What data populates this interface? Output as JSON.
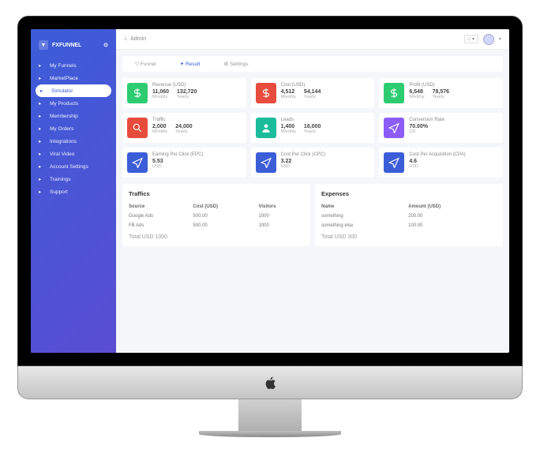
{
  "brand": "FXFUNNEL",
  "topbar": {
    "title": "Admin"
  },
  "nav": [
    {
      "label": "My Funnels"
    },
    {
      "label": "MarketPlace"
    },
    {
      "label": "Simulator",
      "active": true
    },
    {
      "label": "My Products"
    },
    {
      "label": "Membership"
    },
    {
      "label": "My Orders"
    },
    {
      "label": "Integrations"
    },
    {
      "label": "Viral Video"
    },
    {
      "label": "Account Settings"
    },
    {
      "label": "Trainings"
    },
    {
      "label": "Support"
    }
  ],
  "tabs": {
    "funnel": "Funnel",
    "result": "Result",
    "settings": "Settings"
  },
  "cards": [
    {
      "title": "Revenue (USD)",
      "v1": "11,060",
      "s1": "Monthly",
      "v2": "132,720",
      "s2": "Yearly",
      "color": "c-green",
      "icon": "dollar"
    },
    {
      "title": "Cost (USD)",
      "v1": "4,512",
      "s1": "Monthly",
      "v2": "54,144",
      "s2": "Yearly",
      "color": "c-red",
      "icon": "dollar"
    },
    {
      "title": "Profit (USD)",
      "v1": "6,548",
      "s1": "Monthly",
      "v2": "78,576",
      "s2": "Yearly",
      "color": "c-green",
      "icon": "dollar"
    },
    {
      "title": "Traffic",
      "v1": "2,000",
      "s1": "Monthly",
      "v2": "24,000",
      "s2": "Yearly",
      "color": "c-red",
      "icon": "search"
    },
    {
      "title": "Leads",
      "v1": "1,400",
      "s1": "Monthly",
      "v2": "16,000",
      "s2": "Yearly",
      "color": "c-teal",
      "icon": "user"
    },
    {
      "title": "Conversion Rate",
      "v1": "70.00%",
      "s1": "CR",
      "v2": "",
      "s2": "",
      "color": "c-purple",
      "icon": "send"
    },
    {
      "title": "Earning Per Click (EPC)",
      "v1": "5.53",
      "s1": "USD",
      "v2": "",
      "s2": "",
      "color": "c-blue",
      "icon": "send"
    },
    {
      "title": "Cost Per Click (CPC)",
      "v1": "3.22",
      "s1": "USD",
      "v2": "",
      "s2": "",
      "color": "c-blue",
      "icon": "send"
    },
    {
      "title": "Cost Per Acquisition (CPA)",
      "v1": "4.6",
      "s1": "USD",
      "v2": "",
      "s2": "",
      "color": "c-blue",
      "icon": "send"
    }
  ],
  "traffics": {
    "title": "Traffics",
    "headers": {
      "source": "Source",
      "cost": "Cost (USD)",
      "visitors": "Visitors"
    },
    "rows": [
      {
        "source": "Google Ads",
        "cost": "500.00",
        "visitors": "1000"
      },
      {
        "source": "FB Ads",
        "cost": "500.00",
        "visitors": "1000"
      }
    ],
    "total": "Total USD 1000"
  },
  "expenses": {
    "title": "Expenses",
    "headers": {
      "name": "Name",
      "amount": "Amount (USD)"
    },
    "rows": [
      {
        "name": "something",
        "amount": "200.00"
      },
      {
        "name": "something else",
        "amount": "100.00"
      }
    ],
    "total": "Total USD 300"
  }
}
